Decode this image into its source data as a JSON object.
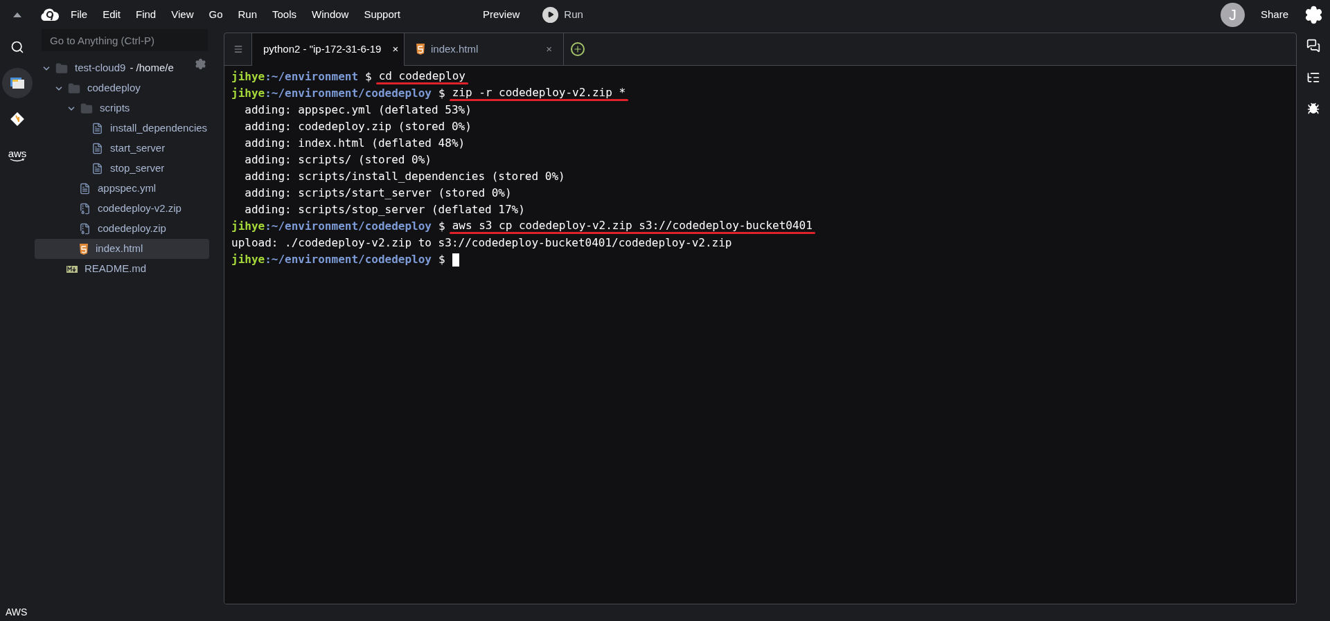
{
  "menu": [
    "File",
    "Edit",
    "Find",
    "View",
    "Go",
    "Run",
    "Tools",
    "Window",
    "Support"
  ],
  "preview": "Preview",
  "run": "Run",
  "avatar": "J",
  "share": "Share",
  "search": {
    "placeholder": "Go to Anything (Ctrl-P)"
  },
  "rail": [
    {
      "kind": "search",
      "selected": false
    },
    {
      "kind": "files",
      "selected": true
    },
    {
      "kind": "git",
      "selected": false
    },
    {
      "kind": "aws",
      "label": "aws",
      "selected": false
    }
  ],
  "tree": [
    {
      "name": "test-cloud9",
      "suffix": "- /home/e",
      "kind": "folder",
      "expanded": true,
      "selected": false,
      "children": [
        {
          "name": "codedeploy",
          "kind": "folder",
          "expanded": true,
          "selected": false,
          "children": [
            {
              "name": "scripts",
              "kind": "folder",
              "expanded": true,
              "selected": false,
              "children": [
                {
                  "name": "install_dependencies",
                  "kind": "file",
                  "selected": false
                },
                {
                  "name": "start_server",
                  "kind": "file",
                  "selected": false
                },
                {
                  "name": "stop_server",
                  "kind": "file",
                  "selected": false
                }
              ]
            },
            {
              "name": "appspec.yml",
              "kind": "file",
              "selected": false
            },
            {
              "name": "codedeploy-v2.zip",
              "kind": "zip",
              "selected": false
            },
            {
              "name": "codedeploy.zip",
              "kind": "zip",
              "selected": false
            },
            {
              "name": "index.html",
              "kind": "html",
              "selected": true
            }
          ]
        },
        {
          "name": "README.md",
          "kind": "md",
          "selected": false
        }
      ]
    }
  ],
  "tabs": [
    {
      "label": "python2 - \"ip-172-31-6-19",
      "close": "×",
      "kind": "terminal",
      "selected": true
    },
    {
      "label": "index.html",
      "close": "×",
      "kind": "html",
      "selected": false
    }
  ],
  "terminal": [
    {
      "kind": "prompt",
      "user": "jihye",
      "path": ":~/environment",
      "symbol": "$",
      "command": "cd codedeploy",
      "underlined": true
    },
    {
      "kind": "prompt",
      "user": "jihye",
      "path": ":~/environment/codedeploy",
      "symbol": "$",
      "command": "zip -r codedeploy-v2.zip *",
      "underlined": true
    },
    {
      "kind": "output",
      "text": "  adding: appspec.yml (deflated 53%)"
    },
    {
      "kind": "output",
      "text": "  adding: codedeploy.zip (stored 0%)"
    },
    {
      "kind": "output",
      "text": "  adding: index.html (deflated 48%)"
    },
    {
      "kind": "output",
      "text": "  adding: scripts/ (stored 0%)"
    },
    {
      "kind": "output",
      "text": "  adding: scripts/install_dependencies (stored 0%)"
    },
    {
      "kind": "output",
      "text": "  adding: scripts/start_server (stored 0%)"
    },
    {
      "kind": "output",
      "text": "  adding: scripts/stop_server (deflated 17%)"
    },
    {
      "kind": "prompt",
      "user": "jihye",
      "path": ":~/environment/codedeploy",
      "symbol": "$",
      "command": "aws s3 cp codedeploy-v2.zip s3://codedeploy-bucket0401",
      "underlined": true
    },
    {
      "kind": "output",
      "text": "upload: ./codedeploy-v2.zip to s3://codedeploy-bucket0401/codedeploy-v2.zip"
    },
    {
      "kind": "prompt",
      "user": "jihye",
      "path": ":~/environment/codedeploy",
      "symbol": "$",
      "cursor": true
    }
  ],
  "status": "AWS"
}
